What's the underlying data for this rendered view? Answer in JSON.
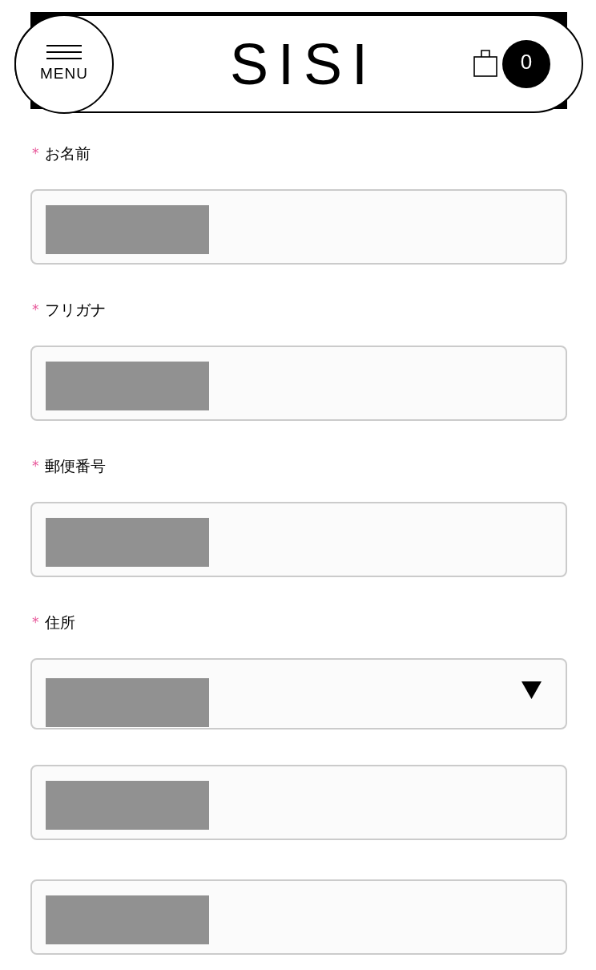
{
  "header": {
    "menu_label": "MENU",
    "logo": "SISI",
    "cart_count": "0"
  },
  "fields": [
    {
      "kind": "text",
      "label": "お名前",
      "required_mark": "*"
    },
    {
      "kind": "text",
      "label": "フリガナ",
      "required_mark": "*"
    },
    {
      "kind": "text",
      "label": "郵便番号",
      "required_mark": "*"
    },
    {
      "kind": "select",
      "label": "住所",
      "required_mark": "*"
    },
    {
      "kind": "text"
    },
    {
      "kind": "text"
    }
  ]
}
